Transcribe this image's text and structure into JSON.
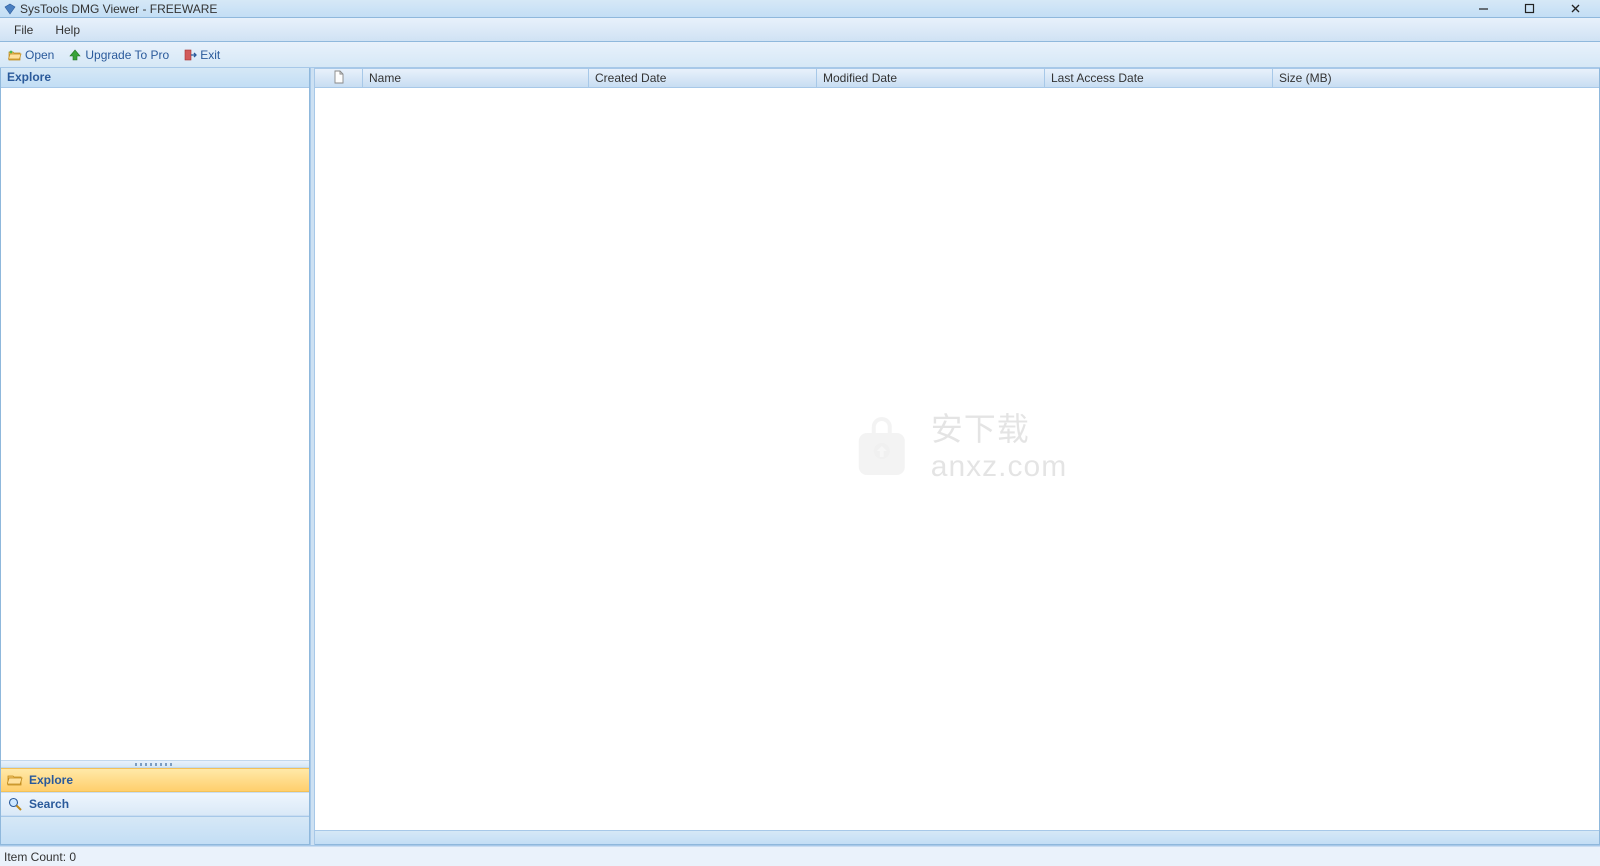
{
  "window": {
    "title": "SysTools DMG Viewer - FREEWARE"
  },
  "menus": {
    "file": "File",
    "help": "Help"
  },
  "toolbar": {
    "open_label": "Open",
    "upgrade_label": "Upgrade To Pro",
    "exit_label": "Exit"
  },
  "sidebar": {
    "header": "Explore",
    "nav_explore": "Explore",
    "nav_search": "Search"
  },
  "columns": {
    "name": "Name",
    "created": "Created Date",
    "modified": "Modified Date",
    "access": "Last Access Date",
    "size": "Size (MB)"
  },
  "watermark": {
    "chinese": "安下载",
    "domain": "anxz.com"
  },
  "status": {
    "item_count_label": "Item Count: 0"
  }
}
